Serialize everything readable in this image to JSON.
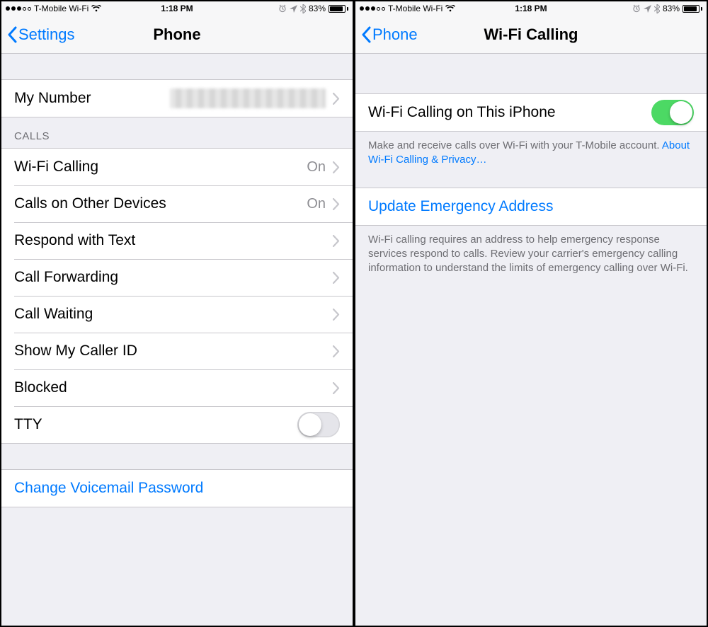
{
  "status": {
    "carrier": "T-Mobile Wi-Fi",
    "time": "1:18 PM",
    "battery_pct": "83%"
  },
  "left": {
    "back_label": "Settings",
    "title": "Phone",
    "my_number_label": "My Number",
    "calls_header": "CALLS",
    "rows": {
      "wifi_calling": {
        "label": "Wi-Fi Calling",
        "value": "On"
      },
      "other_devices": {
        "label": "Calls on Other Devices",
        "value": "On"
      },
      "respond_text": {
        "label": "Respond with Text"
      },
      "call_forwarding": {
        "label": "Call Forwarding"
      },
      "call_waiting": {
        "label": "Call Waiting"
      },
      "show_caller_id": {
        "label": "Show My Caller ID"
      },
      "blocked": {
        "label": "Blocked"
      },
      "tty": {
        "label": "TTY",
        "toggle_on": false
      }
    },
    "change_voicemail": "Change Voicemail Password"
  },
  "right": {
    "back_label": "Phone",
    "title": "Wi-Fi Calling",
    "toggle_row": {
      "label": "Wi-Fi Calling on This iPhone",
      "toggle_on": true
    },
    "footer1_text": "Make and receive calls over Wi-Fi with your T-Mobile account. ",
    "footer1_link": "About Wi-Fi Calling & Privacy…",
    "update_address": "Update Emergency Address",
    "footer2": "Wi-Fi calling requires an address to help emergency response services respond to calls. Review your carrier's emergency calling information to understand the limits of emergency calling over Wi-Fi."
  }
}
